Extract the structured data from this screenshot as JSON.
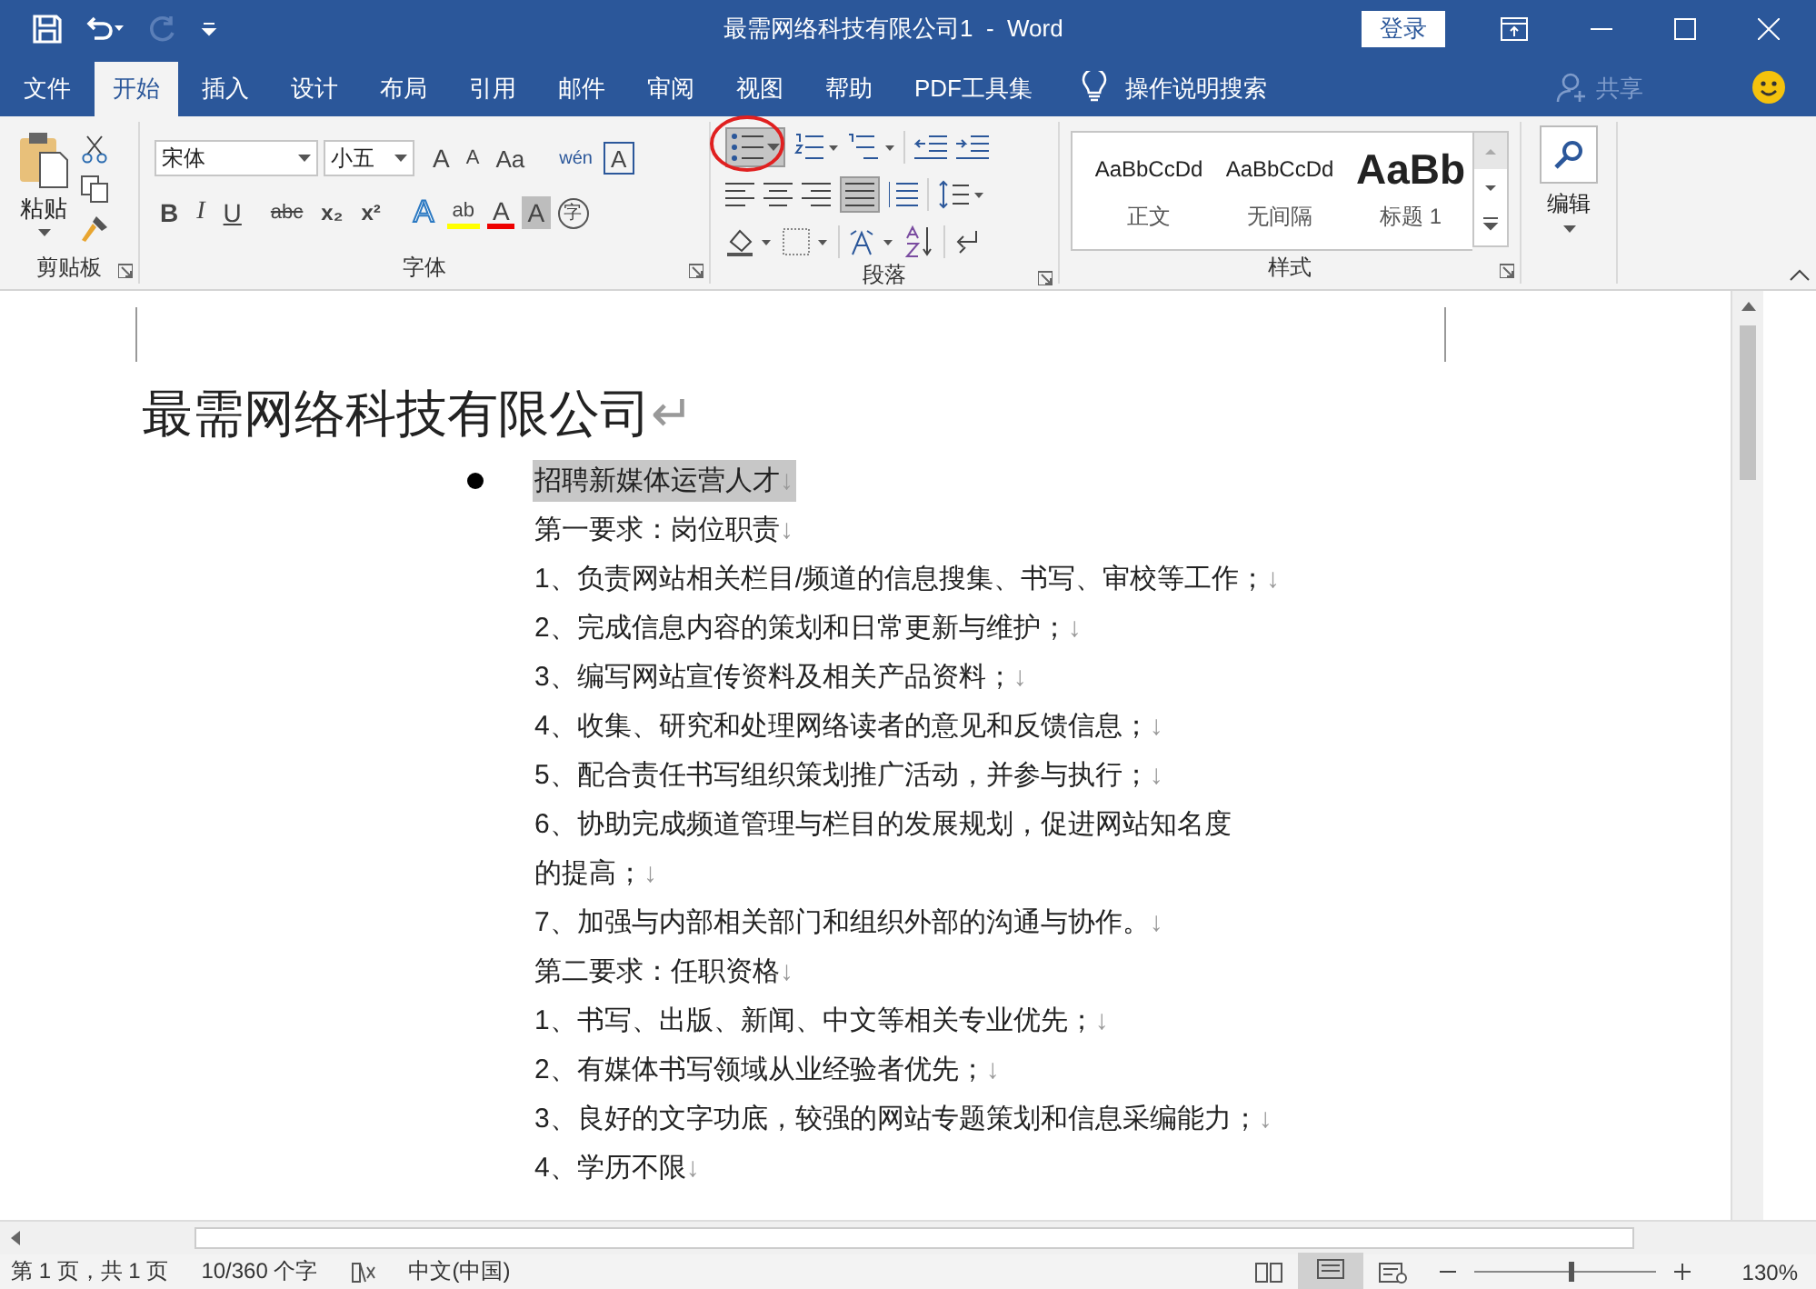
{
  "title_bar": {
    "document_title": "最需网络科技有限公司1  -  Word",
    "login_button": "登录"
  },
  "tabs": [
    {
      "label": "文件",
      "selected": false
    },
    {
      "label": "开始",
      "selected": true
    },
    {
      "label": "插入",
      "selected": false
    },
    {
      "label": "设计",
      "selected": false
    },
    {
      "label": "布局",
      "selected": false
    },
    {
      "label": "引用",
      "selected": false
    },
    {
      "label": "邮件",
      "selected": false
    },
    {
      "label": "审阅",
      "selected": false
    },
    {
      "label": "视图",
      "selected": false
    },
    {
      "label": "帮助",
      "selected": false
    },
    {
      "label": "PDF工具集",
      "selected": false
    }
  ],
  "tell_me": "操作说明搜索",
  "share": "共享",
  "ribbon": {
    "clipboard": {
      "paste": "粘贴",
      "label": "剪贴板"
    },
    "font": {
      "font_name": "宋体",
      "font_size": "小五",
      "label": "字体",
      "row1": [
        {
          "label": "A",
          "kind": "grow"
        },
        {
          "label": "A",
          "kind": "shrink"
        },
        {
          "label": "Aa",
          "kind": "case"
        },
        {
          "label": "wén",
          "kind": "phonetic"
        },
        {
          "label": "A",
          "kind": "border"
        }
      ],
      "row2": [
        {
          "label": "B",
          "kind": "bold"
        },
        {
          "label": "I",
          "kind": "italic"
        },
        {
          "label": "U",
          "kind": "underline"
        },
        {
          "label": "abc",
          "kind": "strike"
        },
        {
          "label": "x₂",
          "kind": "sub"
        },
        {
          "label": "x²",
          "kind": "sup"
        },
        {
          "label": "A",
          "kind": "effects"
        },
        {
          "label": "ab",
          "kind": "highlight"
        },
        {
          "label": "A",
          "kind": "color"
        },
        {
          "label": "A",
          "kind": "shading"
        },
        {
          "label": "字",
          "kind": "enclose"
        }
      ]
    },
    "paragraph": {
      "label": "段落",
      "bullets_on": true,
      "justify_on": true
    },
    "styles": {
      "label": "样式",
      "items": [
        {
          "sample": "AaBbCcDd",
          "name": "正文",
          "kind": "normal"
        },
        {
          "sample": "AaBbCcDd",
          "name": "无间隔",
          "kind": "normal"
        },
        {
          "sample": "AaBb",
          "name": "标题 1",
          "kind": "heading"
        }
      ]
    },
    "editing": {
      "label": "编辑"
    }
  },
  "document": {
    "heading": "最需网络科技有限公司",
    "heading_mark": "↵",
    "lines": [
      {
        "text": "招聘新媒体运营人才",
        "mark": "↓",
        "bullet": true,
        "highlighted": true
      },
      {
        "text": "第一要求：岗位职责",
        "mark": "↓",
        "bullet": false,
        "highlighted": false
      },
      {
        "text": "1、负责网站相关栏目/频道的信息搜集、书写、审校等工作；",
        "mark": "↓",
        "bullet": false,
        "highlighted": false
      },
      {
        "text": "2、完成信息内容的策划和日常更新与维护；",
        "mark": "↓",
        "bullet": false,
        "highlighted": false
      },
      {
        "text": "3、编写网站宣传资料及相关产品资料；",
        "mark": "↓",
        "bullet": false,
        "highlighted": false
      },
      {
        "text": "4、收集、研究和处理网络读者的意见和反馈信息；",
        "mark": "↓",
        "bullet": false,
        "highlighted": false
      },
      {
        "text": "5、配合责任书写组织策划推广活动，并参与执行；",
        "mark": "↓",
        "bullet": false,
        "highlighted": false
      },
      {
        "text": "6、协助完成频道管理与栏目的发展规划，促进网站知名度",
        "bullet": false,
        "highlighted": false
      },
      {
        "text": "的提高；",
        "mark": "↓",
        "bullet": false,
        "highlighted": false
      },
      {
        "text": "7、加强与内部相关部门和组织外部的沟通与协作。",
        "mark": "↓",
        "bullet": false,
        "highlighted": false
      },
      {
        "text": "第二要求：任职资格",
        "mark": "↓",
        "bullet": false,
        "highlighted": false
      },
      {
        "text": "1、书写、出版、新闻、中文等相关专业优先；",
        "mark": "↓",
        "bullet": false,
        "highlighted": false
      },
      {
        "text": "2、有媒体书写领域从业经验者优先；",
        "mark": "↓",
        "bullet": false,
        "highlighted": false
      },
      {
        "text": "3、良好的文字功底，较强的网站专题策划和信息采编能力；",
        "mark": "↓",
        "bullet": false,
        "highlighted": false
      },
      {
        "text": "4、学历不限",
        "mark": "↓",
        "bullet": false,
        "highlighted": false
      }
    ]
  },
  "status_bar": {
    "page": "第 1 页，共 1 页",
    "words": "10/360 个字",
    "language": "中文(中国)",
    "zoom": "130%",
    "zoom_slider": {
      "level": 0.52
    }
  }
}
